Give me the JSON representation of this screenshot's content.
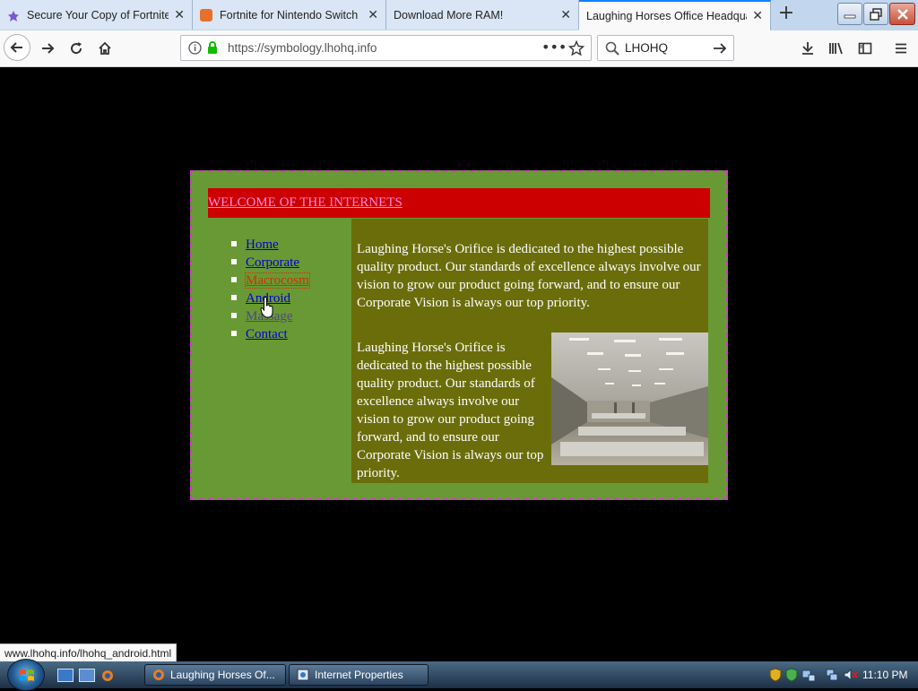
{
  "browser": {
    "tabs": [
      {
        "label": "Secure Your Copy of Fortnite",
        "icon": "star-favicon-icon",
        "active": false
      },
      {
        "label": "Fortnite for Nintendo Switch",
        "icon": "nintendo-favicon-icon",
        "active": false
      },
      {
        "label": "Download More RAM!",
        "icon": "blank-favicon-icon",
        "active": false
      },
      {
        "label": "Laughing Horses Office Headquarters",
        "icon": "blank-favicon-icon",
        "active": true
      }
    ],
    "url": "https://symbology.lhohq.info",
    "search_value": "LHOHQ",
    "status_url": "www.lhohq.info/lhohq_android.html"
  },
  "page": {
    "banner_link": "WELCOME OF THE INTERNETS",
    "nav": [
      {
        "label": "Home",
        "color": "#0000cc",
        "state": "link"
      },
      {
        "label": "Corporate",
        "color": "#0000cc",
        "state": "link"
      },
      {
        "label": "Macrocosm",
        "color": "#cc3300",
        "state": "active"
      },
      {
        "label": "Android",
        "color": "#0000cc",
        "state": "hover"
      },
      {
        "label": "Massage",
        "color": "#4b4b7a",
        "state": "visited"
      },
      {
        "label": "Contact",
        "color": "#0000cc",
        "state": "link"
      }
    ],
    "paragraph_1": "Laughing Horse's Orifice is dedicated to the highest possible quality product. Our standards of excellence always involve our vision to grow our product going forward, and to ensure our Corporate Vision is always our top priority.",
    "paragraph_2": "Laughing Horse's Orifice is dedicated to the highest possible quality product. Our standards of excellence always involve our vision to grow our product going forward, and to ensure our Corporate Vision is always our top priority."
  },
  "taskbar": {
    "buttons": [
      {
        "label": "Laughing Horses Of...",
        "icon": "firefox-icon"
      },
      {
        "label": "Internet Properties",
        "icon": "internet-properties-icon"
      }
    ],
    "clock": "11:10 PM"
  },
  "colors": {
    "frame_bg": "#699935",
    "frame_border": "#d03cc8",
    "banner_bg": "#cc0000",
    "banner_link": "#ff8ad8",
    "content_bg": "#6b6d0b"
  }
}
